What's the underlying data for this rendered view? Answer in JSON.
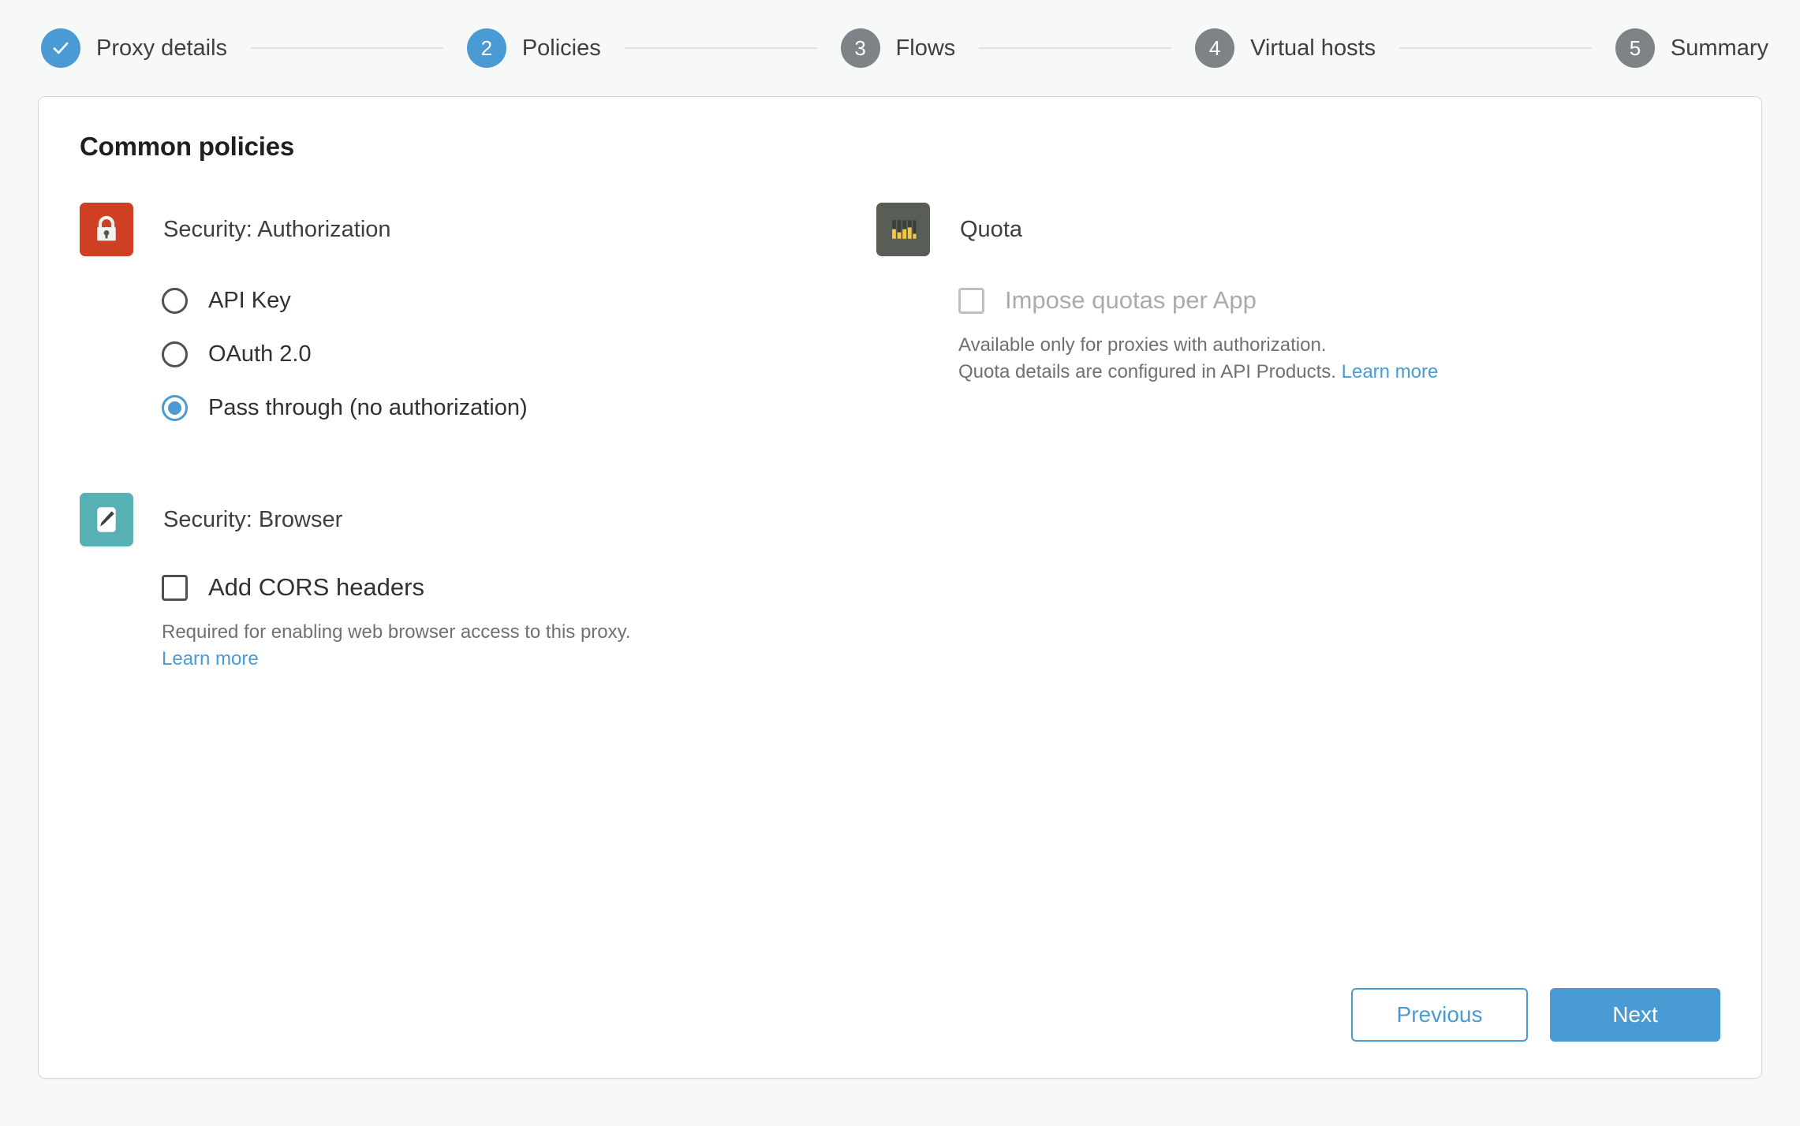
{
  "stepper": {
    "steps": [
      {
        "label": "Proxy details",
        "number": "1",
        "state": "done",
        "icon": "check-icon"
      },
      {
        "label": "Policies",
        "number": "2",
        "state": "active",
        "icon": ""
      },
      {
        "label": "Flows",
        "number": "3",
        "state": "todo",
        "icon": ""
      },
      {
        "label": "Virtual hosts",
        "number": "4",
        "state": "todo",
        "icon": ""
      },
      {
        "label": "Summary",
        "number": "5",
        "state": "todo",
        "icon": ""
      }
    ]
  },
  "card": {
    "title": "Common policies"
  },
  "policies": {
    "authorization": {
      "icon": "lock-icon",
      "icon_color": "#cf3f23",
      "name": "Security: Authorization",
      "options": [
        {
          "label": "API Key",
          "checked": false
        },
        {
          "label": "OAuth 2.0",
          "checked": false
        },
        {
          "label": "Pass through (no authorization)",
          "checked": true
        }
      ]
    },
    "browser": {
      "icon": "pencil-icon",
      "icon_color": "#56b0b4",
      "name": "Security: Browser",
      "checkbox_label": "Add CORS headers",
      "checked": false,
      "disabled": false,
      "help_text": "Required for enabling web browser access to this proxy.",
      "link_label": "Learn more"
    },
    "quota": {
      "icon": "quota-bars-icon",
      "icon_color": "#585e56",
      "name": "Quota",
      "checkbox_label": "Impose quotas per App",
      "checked": false,
      "disabled": true,
      "help_line1": "Available only for proxies with authorization.",
      "help_line2": "Quota details are configured in API Products.",
      "link_label": "Learn more"
    }
  },
  "footer": {
    "previous_label": "Previous",
    "next_label": "Next"
  },
  "colors": {
    "accent": "#4a9bd4",
    "page_bg": "#f7f8f8",
    "card_bg": "#ffffff",
    "border": "#d6d8d9",
    "muted_text": "#6d7174",
    "step_todo": "#7d8386"
  }
}
